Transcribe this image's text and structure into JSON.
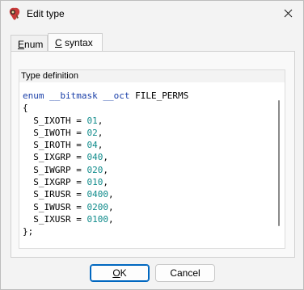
{
  "window": {
    "title": "Edit type"
  },
  "tabs": [
    {
      "label_pre": "",
      "label_ul": "E",
      "label_post": "num"
    },
    {
      "label_pre": "",
      "label_ul": "C",
      "label_post": " syntax"
    }
  ],
  "group": {
    "label": "Type definition"
  },
  "code": {
    "line1_kw": "enum __bitmask __oct",
    "line1_name": " FILE_PERMS",
    "open_brace": "{",
    "entries": [
      {
        "name": "  S_IXOTH = ",
        "value": "01"
      },
      {
        "name": "  S_IWOTH = ",
        "value": "02"
      },
      {
        "name": "  S_IROTH = ",
        "value": "04"
      },
      {
        "name": "  S_IXGRP = ",
        "value": "040"
      },
      {
        "name": "  S_IWGRP = ",
        "value": "020"
      },
      {
        "name": "  S_IXGRP = ",
        "value": "010"
      },
      {
        "name": "  S_IRUSR = ",
        "value": "0400"
      },
      {
        "name": "  S_IWUSR = ",
        "value": "0200"
      },
      {
        "name": "  S_IXUSR = ",
        "value": "0100"
      }
    ],
    "close_brace": "};"
  },
  "buttons": {
    "ok_ul": "O",
    "ok_rest": "K",
    "cancel": "Cancel"
  },
  "colors": {
    "keyword": "#1a3fa8",
    "number": "#0e8a8a",
    "accent": "#0067c0"
  }
}
